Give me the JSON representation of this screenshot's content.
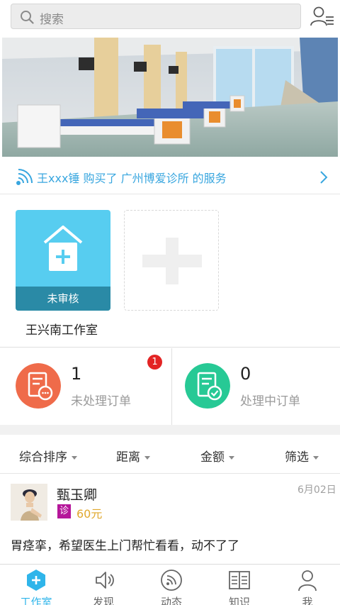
{
  "search": {
    "placeholder": "搜索"
  },
  "notice": {
    "text": "王xxx锤 购买了 广州博爱诊所 的服务"
  },
  "studio": {
    "status_badge": "未审核",
    "name": "王兴南工作室"
  },
  "orders": {
    "unprocessed": {
      "count": "1",
      "label": "未处理订单",
      "badge": "1"
    },
    "processing": {
      "count": "0",
      "label": "处理中订单"
    }
  },
  "filters": [
    "综合排序",
    "距离",
    "金额",
    "筛选"
  ],
  "order_card": {
    "name": "甄玉卿",
    "date": "6月02日",
    "tag": "诊",
    "price": "60元",
    "description": "胃痉挛，希望医生上门帮忙看看，动不了了"
  },
  "tabs": [
    {
      "label": "工作室",
      "icon": "workstation-icon",
      "active": true
    },
    {
      "label": "发现",
      "icon": "speaker-icon",
      "active": false
    },
    {
      "label": "动态",
      "icon": "feed-icon",
      "active": false
    },
    {
      "label": "知识",
      "icon": "book-icon",
      "active": false
    },
    {
      "label": "我",
      "icon": "person-icon",
      "active": false
    }
  ],
  "colors": {
    "accent": "#2fb5ea",
    "studio_card": "#57cdf0",
    "unprocessed": "#ef6b4a",
    "processing": "#27c995",
    "badge": "#e32424"
  }
}
